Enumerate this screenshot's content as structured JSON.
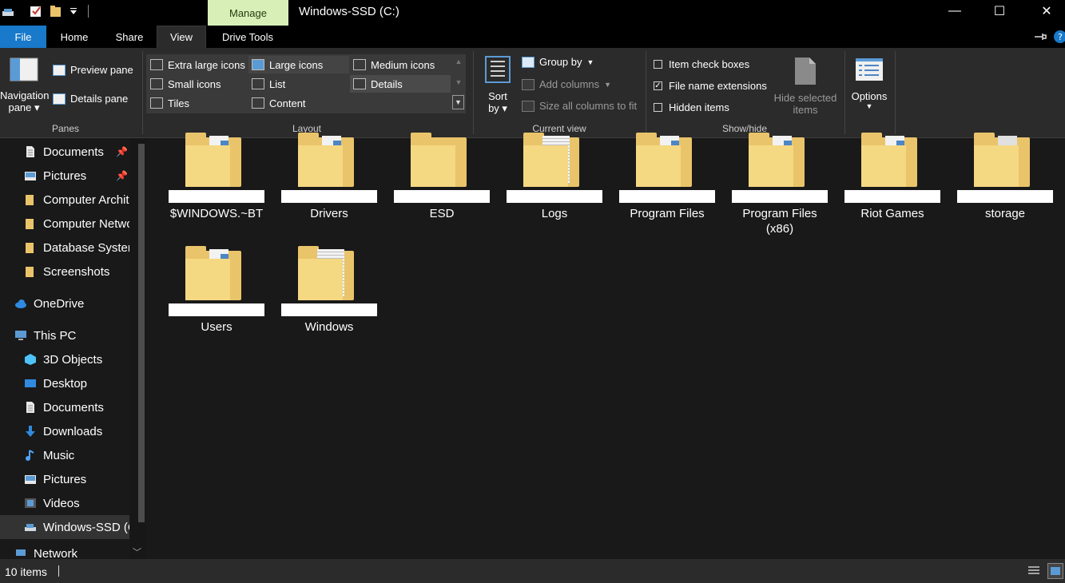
{
  "window": {
    "title": "Windows-SSD (C:)",
    "manage_tab": "Manage",
    "minimize_glyph": "—",
    "maximize_glyph": "☐",
    "close_glyph": "✕"
  },
  "ribbon_tabs": [
    "File",
    "Home",
    "Share",
    "View",
    "Drive Tools"
  ],
  "ribbon": {
    "panes": {
      "nav_pane_line1": "Navigation",
      "nav_pane_line2": "pane",
      "preview_pane": "Preview pane",
      "details_pane": "Details pane",
      "group_label": "Panes"
    },
    "layout": {
      "items": [
        "Extra large icons",
        "Large icons",
        "Medium icons",
        "Small icons",
        "List",
        "Details",
        "Tiles",
        "Content"
      ],
      "selected": "Details",
      "group_label": "Layout"
    },
    "current_view": {
      "sort_line1": "Sort",
      "sort_line2": "by",
      "group_by": "Group by",
      "add_columns": "Add columns",
      "size_columns": "Size all columns to fit",
      "group_label": "Current view"
    },
    "show_hide": {
      "item_check_boxes": "Item check boxes",
      "item_check_boxes_checked": false,
      "file_name_extensions": "File name extensions",
      "file_name_extensions_checked": true,
      "hidden_items": "Hidden items",
      "hidden_items_checked": false,
      "hide_selected_line1": "Hide selected",
      "hide_selected_line2": "items",
      "group_label": "Show/hide"
    },
    "options": "Options"
  },
  "nav": {
    "items": [
      {
        "label": "Documents",
        "icon": "document-icon",
        "pinned": true
      },
      {
        "label": "Pictures",
        "icon": "pictures-icon",
        "pinned": true
      },
      {
        "label": "Computer Archit",
        "icon": "folder-icon"
      },
      {
        "label": "Computer Netwo",
        "icon": "folder-icon"
      },
      {
        "label": "Database Systen",
        "icon": "folder-icon"
      },
      {
        "label": "Screenshots",
        "icon": "folder-icon"
      },
      {
        "label": "OneDrive",
        "icon": "onedrive-icon"
      },
      {
        "label": "This PC",
        "icon": "this-pc-icon"
      },
      {
        "label": "3D Objects",
        "icon": "3d-objects-icon"
      },
      {
        "label": "Desktop",
        "icon": "desktop-icon"
      },
      {
        "label": "Documents",
        "icon": "document-icon"
      },
      {
        "label": "Downloads",
        "icon": "downloads-icon"
      },
      {
        "label": "Music",
        "icon": "music-icon"
      },
      {
        "label": "Pictures",
        "icon": "pictures-icon"
      },
      {
        "label": "Videos",
        "icon": "videos-icon"
      },
      {
        "label": "Windows-SSD (C",
        "icon": "drive-icon",
        "selected": true
      },
      {
        "label": "Network",
        "icon": "network-icon"
      }
    ]
  },
  "folders": [
    {
      "name": "$WINDOWS.~BT",
      "style": "docs"
    },
    {
      "name": "Drivers",
      "style": "docs"
    },
    {
      "name": "ESD",
      "style": "empty"
    },
    {
      "name": "Logs",
      "style": "text"
    },
    {
      "name": "Program Files",
      "style": "docs"
    },
    {
      "name": "Program Files\n(x86)",
      "style": "docs"
    },
    {
      "name": "Riot Games",
      "style": "docs"
    },
    {
      "name": "storage",
      "style": "gears"
    },
    {
      "name": "Users",
      "style": "docs"
    },
    {
      "name": "Windows",
      "style": "text"
    }
  ],
  "status": {
    "count": "10 items"
  },
  "colors": {
    "accent": "#1979ca",
    "manage": "#d8f0b8",
    "folder": "#e9c46a",
    "background": "#191919",
    "ribbon": "#2b2b2b"
  }
}
